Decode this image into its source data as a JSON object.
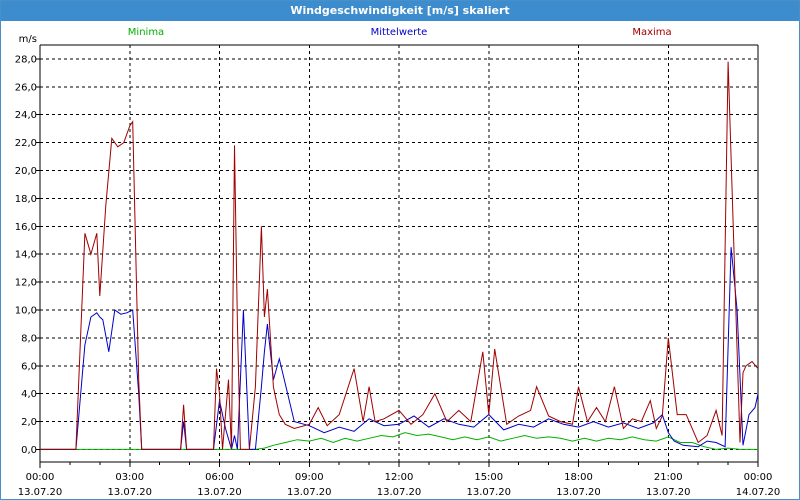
{
  "window": {
    "title": "Windgeschwindigkeit [m/s] skaliert"
  },
  "colors": {
    "min": "#00b000",
    "mean": "#0000c8",
    "max": "#a00000",
    "grid": "#000000",
    "axis": "#000000"
  },
  "chart_data": {
    "type": "line",
    "title": "Windgeschwindigkeit [m/s] skaliert",
    "ylabel": "m/s",
    "xlabel": "",
    "ylim": [
      -0.9,
      29.0
    ],
    "xlim": [
      0,
      24
    ],
    "y_ticks": [
      "0,0",
      "2,0",
      "4,0",
      "6,0",
      "8,0",
      "10,0",
      "12,0",
      "14,0",
      "16,0",
      "18,0",
      "20,0",
      "22,0",
      "24,0",
      "26,0",
      "28,0"
    ],
    "x_ticks": [
      {
        "time": "00:00",
        "date": "13.07.20"
      },
      {
        "time": "03:00",
        "date": "13.07.20"
      },
      {
        "time": "06:00",
        "date": "13.07.20"
      },
      {
        "time": "09:00",
        "date": "13.07.20"
      },
      {
        "time": "12:00",
        "date": "13.07.20"
      },
      {
        "time": "15:00",
        "date": "13.07.20"
      },
      {
        "time": "18:00",
        "date": "13.07.20"
      },
      {
        "time": "21:00",
        "date": "13.07.20"
      },
      {
        "time": "00:00",
        "date": "14.07.20"
      }
    ],
    "grid": true,
    "legend": "top",
    "series": [
      {
        "name": "Minima",
        "key": "min",
        "x": [
          0,
          7.2,
          7.5,
          7.8,
          8.2,
          8.6,
          9.0,
          9.4,
          9.8,
          10.2,
          10.6,
          11.0,
          11.4,
          11.8,
          12.2,
          12.6,
          13.0,
          13.4,
          13.8,
          14.2,
          14.6,
          15.0,
          15.4,
          15.8,
          16.2,
          16.6,
          17.0,
          17.4,
          17.8,
          18.2,
          18.6,
          19.0,
          19.4,
          19.8,
          20.2,
          20.6,
          21.0,
          21.4,
          21.8,
          22.2,
          22.6,
          23.0,
          23.4,
          23.8,
          24.0
        ],
        "values": [
          0,
          0,
          0.1,
          0.3,
          0.5,
          0.7,
          0.6,
          0.8,
          0.5,
          0.8,
          0.6,
          0.8,
          1.0,
          0.9,
          1.2,
          1.0,
          1.1,
          0.9,
          0.7,
          0.9,
          0.7,
          0.9,
          0.6,
          0.8,
          1.0,
          0.8,
          0.9,
          0.8,
          0.6,
          0.8,
          0.6,
          0.8,
          0.7,
          0.9,
          0.7,
          0.6,
          0.9,
          0.5,
          0.5,
          0.2,
          0.0,
          0.1,
          0.0,
          0.0,
          0.0
        ]
      },
      {
        "name": "Mittelwerte",
        "key": "mean",
        "x": [
          0,
          1.2,
          1.5,
          1.7,
          1.9,
          2.0,
          2.1,
          2.3,
          2.5,
          2.7,
          2.9,
          3.1,
          3.3,
          3.4,
          4.7,
          4.8,
          4.9,
          5.5,
          5.8,
          6.0,
          6.2,
          6.4,
          6.5,
          6.6,
          6.8,
          7.0,
          7.2,
          7.4,
          7.5,
          7.6,
          7.8,
          8.0,
          8.5,
          9.0,
          9.5,
          10.0,
          10.5,
          11.0,
          11.5,
          12.0,
          12.5,
          13.0,
          13.5,
          14.0,
          14.5,
          15.0,
          15.5,
          16.0,
          16.5,
          17.0,
          17.5,
          18.0,
          18.5,
          19.0,
          19.5,
          20.0,
          20.5,
          20.8,
          21.0,
          21.2,
          21.5,
          22.0,
          22.3,
          22.6,
          22.9,
          23.1,
          23.3,
          23.5,
          23.7,
          23.9,
          24.0
        ],
        "values": [
          0,
          0,
          7.5,
          9.5,
          9.8,
          9.5,
          9.3,
          7.0,
          10.0,
          9.7,
          9.8,
          10.0,
          4.0,
          0,
          0,
          2.0,
          0,
          0,
          0,
          3.5,
          1.5,
          0,
          1.0,
          0,
          10.0,
          0,
          0,
          4.5,
          7.0,
          9.0,
          5.0,
          6.5,
          2.0,
          1.7,
          1.2,
          1.6,
          1.3,
          2.2,
          1.7,
          1.8,
          2.4,
          1.6,
          2.2,
          1.8,
          1.6,
          2.5,
          1.4,
          1.8,
          1.6,
          2.2,
          1.8,
          1.6,
          2.0,
          1.6,
          1.9,
          1.5,
          1.9,
          2.5,
          1.2,
          0.6,
          0.3,
          0.2,
          0.6,
          0.5,
          0.2,
          14.5,
          10.0,
          0.3,
          2.5,
          3.0,
          4.0
        ]
      },
      {
        "name": "Maxima",
        "key": "max",
        "x": [
          0,
          1.2,
          1.5,
          1.7,
          1.9,
          2.0,
          2.2,
          2.4,
          2.6,
          2.8,
          3.0,
          3.1,
          3.3,
          3.4,
          4.7,
          4.8,
          4.9,
          5.5,
          5.8,
          5.9,
          6.0,
          6.1,
          6.3,
          6.4,
          6.5,
          6.6,
          6.7,
          6.8,
          7.0,
          7.2,
          7.4,
          7.5,
          7.6,
          7.8,
          7.9,
          8.0,
          8.2,
          8.5,
          9.0,
          9.3,
          9.6,
          10.0,
          10.5,
          10.8,
          11.0,
          11.2,
          11.5,
          12.0,
          12.4,
          12.8,
          13.2,
          13.6,
          14.0,
          14.4,
          14.8,
          15.0,
          15.2,
          15.6,
          16.0,
          16.4,
          16.6,
          17.0,
          17.4,
          17.8,
          18.0,
          18.3,
          18.6,
          18.9,
          19.2,
          19.5,
          19.8,
          20.1,
          20.4,
          20.6,
          20.8,
          21.0,
          21.3,
          21.6,
          22.0,
          22.3,
          22.6,
          22.8,
          23.0,
          23.2,
          23.4,
          23.5,
          23.6,
          23.8,
          24.0
        ],
        "values": [
          0,
          0,
          15.5,
          14.0,
          15.5,
          11.0,
          17.5,
          22.3,
          21.7,
          22.0,
          23.2,
          23.5,
          5.0,
          0,
          0,
          3.2,
          0,
          0,
          0,
          5.8,
          4.0,
          0,
          5.0,
          0,
          21.8,
          9.0,
          0,
          0,
          0,
          4.5,
          16.0,
          9.5,
          11.5,
          4.5,
          3.5,
          2.5,
          1.8,
          1.5,
          1.8,
          3.0,
          1.7,
          2.5,
          5.8,
          2.0,
          4.5,
          2.0,
          2.2,
          2.8,
          1.8,
          2.5,
          4.0,
          2.0,
          2.8,
          2.0,
          7.0,
          2.5,
          7.2,
          1.8,
          2.4,
          2.8,
          4.5,
          2.4,
          2.0,
          1.8,
          4.5,
          2.0,
          3.0,
          2.0,
          4.5,
          1.5,
          2.2,
          2.0,
          3.5,
          1.5,
          2.4,
          8.0,
          2.5,
          2.5,
          0.5,
          1.0,
          2.8,
          1.0,
          27.8,
          14.0,
          0.5,
          5.5,
          6.0,
          6.3,
          5.8
        ]
      }
    ]
  }
}
